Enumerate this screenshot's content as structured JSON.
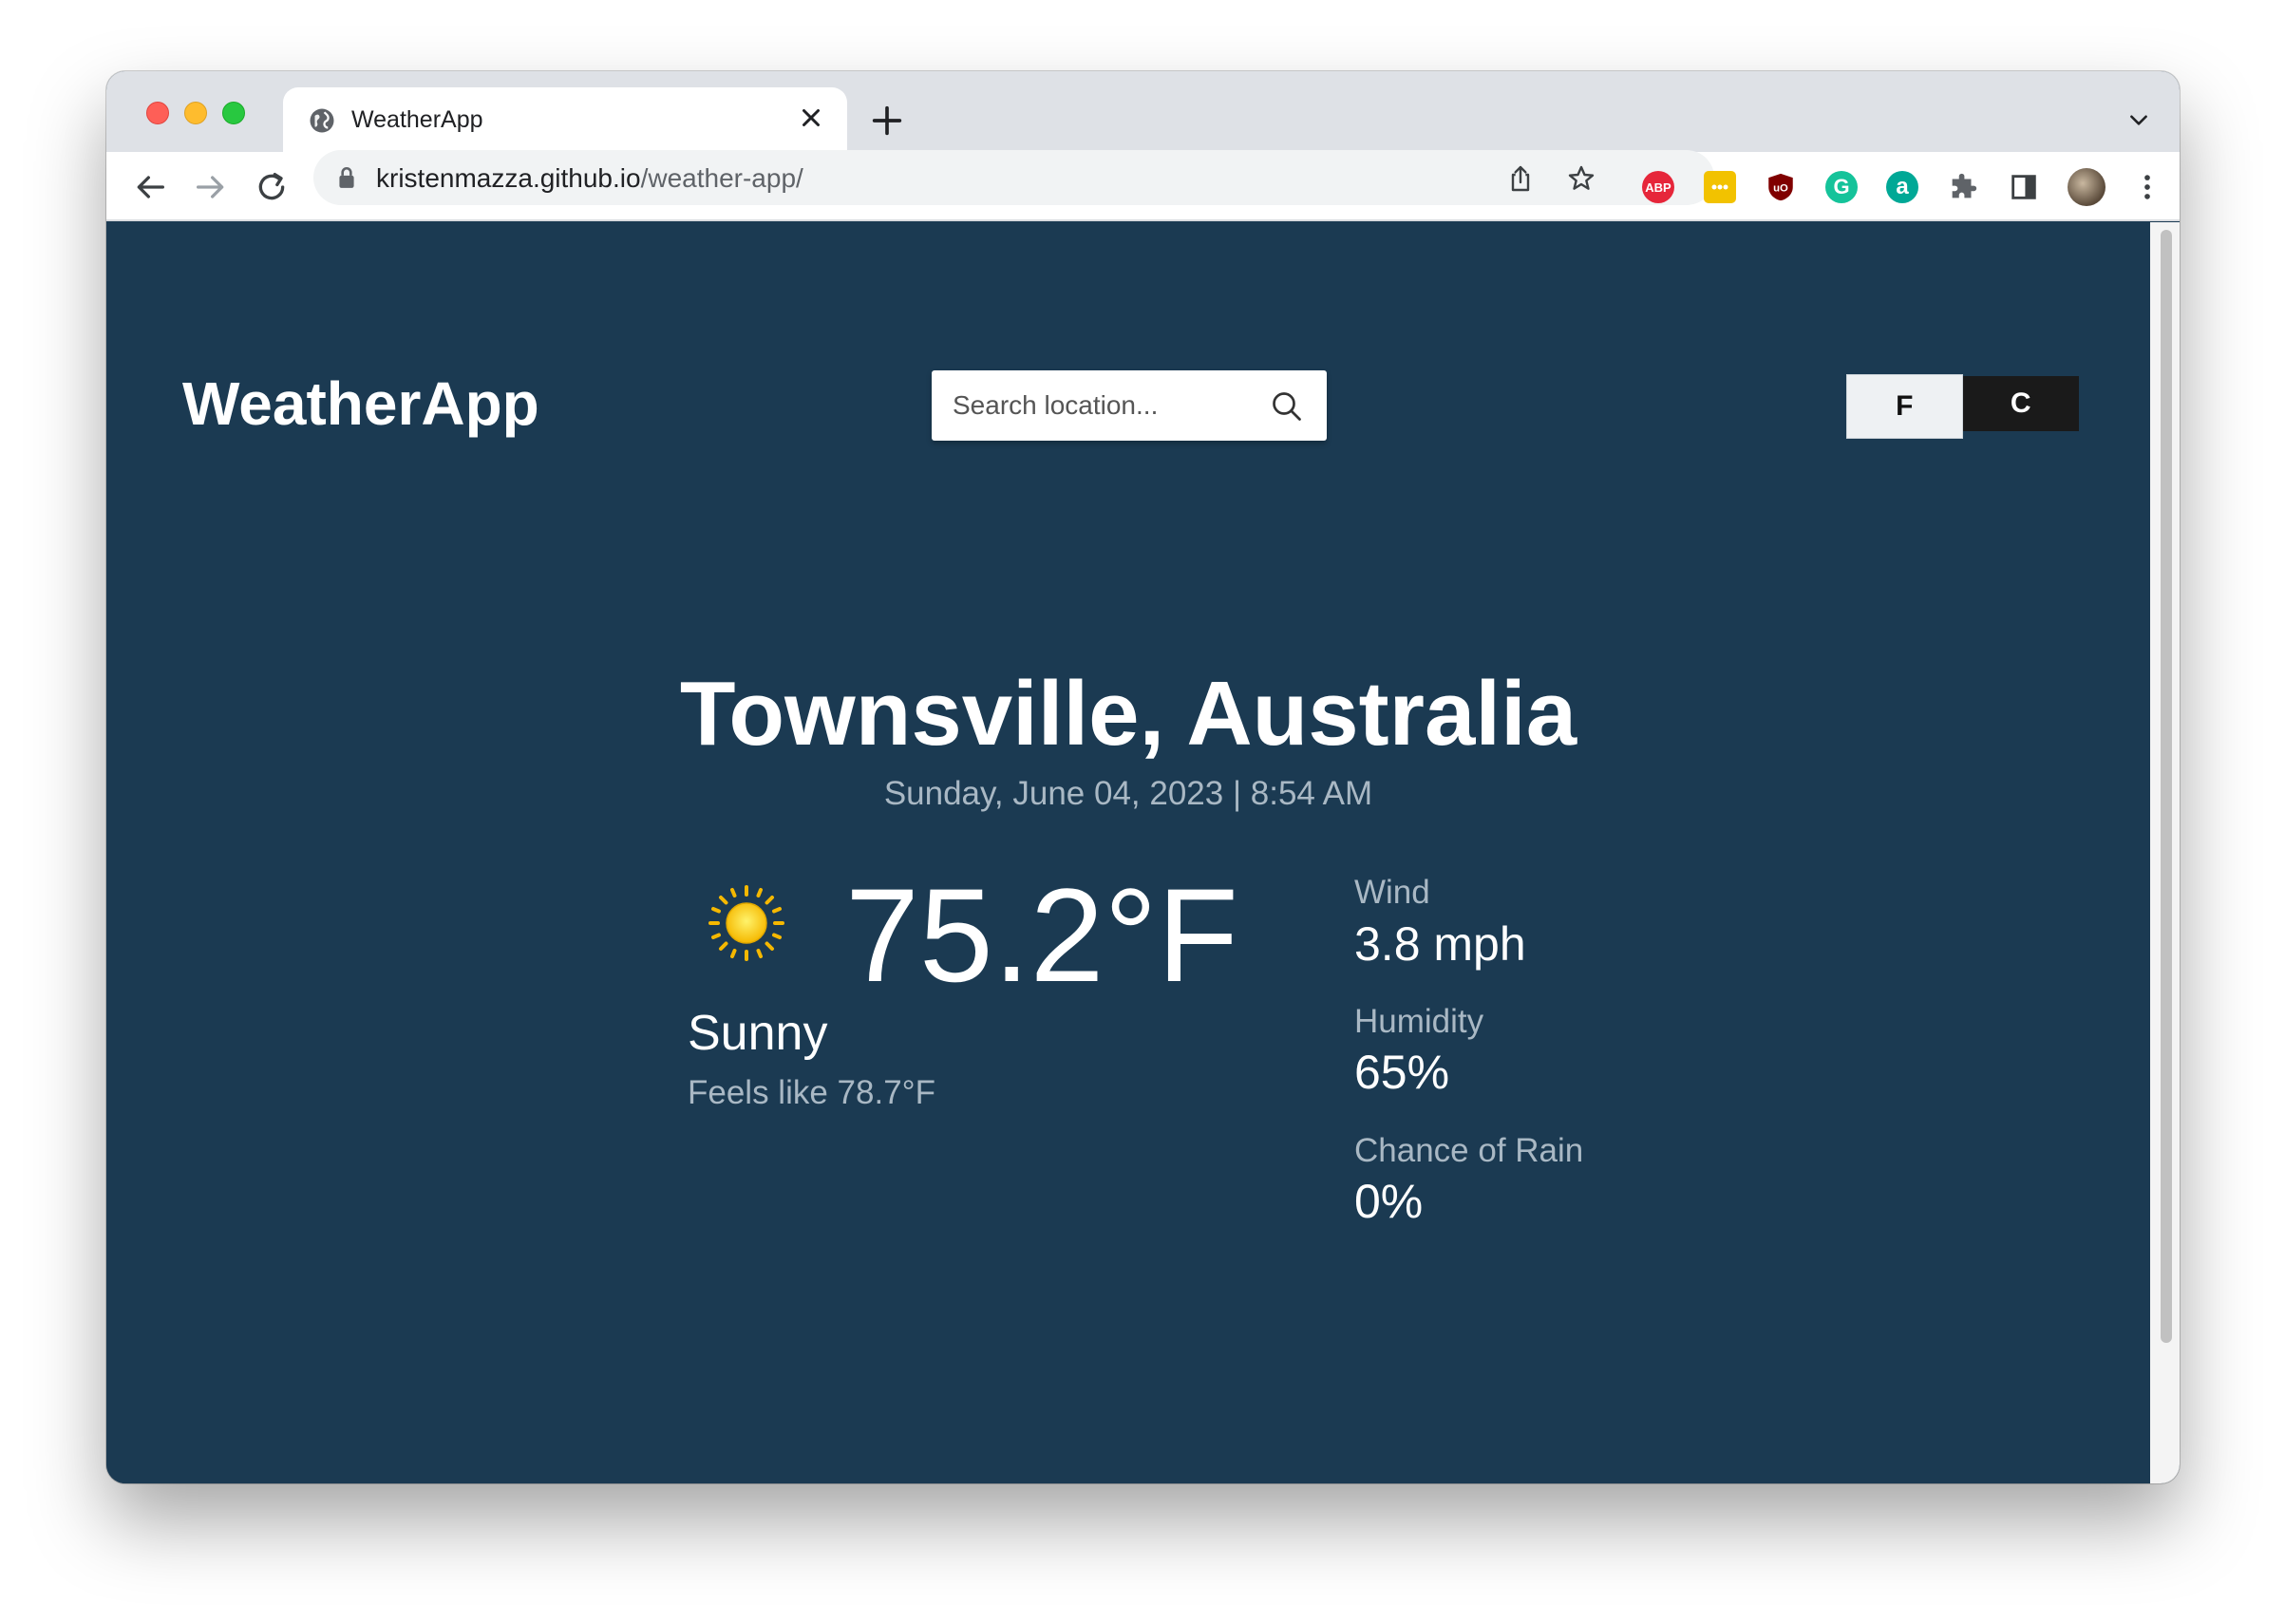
{
  "browser": {
    "tab_title": "WeatherApp",
    "url_host": "kristenmazza.github.io",
    "url_path": "/weather-app/"
  },
  "app": {
    "brand": "WeatherApp",
    "search_placeholder": "Search location...",
    "units": {
      "f_label": "F",
      "c_label": "C",
      "selected": "F"
    }
  },
  "weather": {
    "location": "Townsville, Australia",
    "datetime": "Sunday, June 04, 2023 | 8:54 AM",
    "temperature": "75.2°F",
    "condition": "Sunny",
    "feels_like": "Feels like 78.7°F",
    "condition_icon": "sun-icon",
    "stats": {
      "wind_label": "Wind",
      "wind_value": "3.8 mph",
      "humidity_label": "Humidity",
      "humidity_value": "65%",
      "rain_label": "Chance of Rain",
      "rain_value": "0%"
    }
  },
  "colors": {
    "page_bg": "#1b3a52",
    "muted_text": "#a9b8c4",
    "sun": "#f5c400"
  }
}
